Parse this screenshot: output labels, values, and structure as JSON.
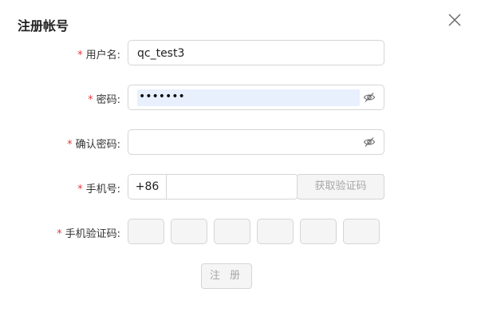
{
  "dialog": {
    "title": "注册帐号",
    "close_icon": "close-icon"
  },
  "form": {
    "required_mark": "*",
    "username": {
      "label": "用户名:",
      "value": "qc_test3"
    },
    "password": {
      "label": "密码:",
      "value": "•••••••",
      "toggle_icon": "eye-off-icon"
    },
    "confirm_password": {
      "label": "确认密码:",
      "value": "",
      "toggle_icon": "eye-off-icon"
    },
    "phone": {
      "label": "手机号:",
      "prefix": "+86",
      "value": "",
      "get_code_label": "获取验证码"
    },
    "sms_code": {
      "label": "手机验证码:",
      "cells": [
        "",
        "",
        "",
        "",
        "",
        ""
      ]
    },
    "submit_label": "注 册"
  },
  "colors": {
    "required": "#e4393c",
    "autofill": "#e8f0fe",
    "disabled_text": "#a8a8a8",
    "border": "#d5d5d5"
  }
}
